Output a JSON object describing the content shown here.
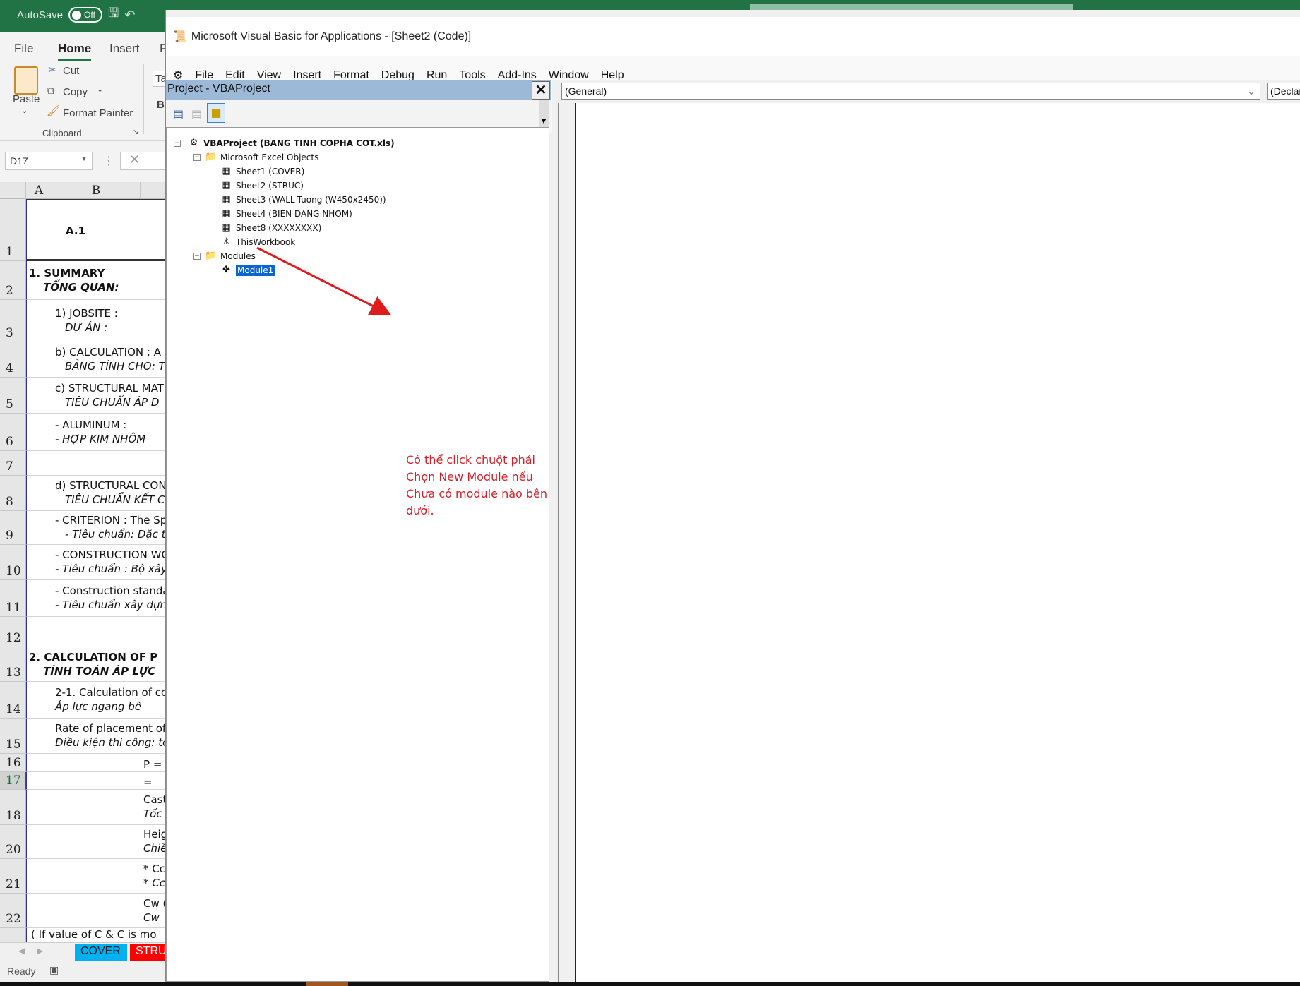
{
  "excel": {
    "autosave_label": "AutoSave",
    "autosave_state": "Off",
    "ribbon_tabs": [
      "File",
      "Home",
      "Insert",
      "P"
    ],
    "active_tab": "Home",
    "clipboard": {
      "paste": "Paste",
      "cut": "Cut",
      "copy": "Copy",
      "format_painter": "Format Painter",
      "group": "Clipboard"
    },
    "font_box_partial": "Ta",
    "bold_partial": "B",
    "name_box": "D17",
    "columns": [
      "A",
      "B"
    ],
    "rows": [
      {
        "n": "1",
        "lines": [
          {
            "t": "A.1",
            "s": "bold"
          }
        ]
      },
      {
        "n": "2",
        "lines": [
          {
            "t": "1. SUMMARY",
            "s": "bold"
          },
          {
            "t": "TỔNG QUAN:",
            "s": "bolditalic"
          }
        ]
      },
      {
        "n": "3",
        "lines": [
          {
            "t": "1) JOBSITE :",
            "s": ""
          },
          {
            "t": "DỰ ÁN :",
            "s": "italic"
          }
        ]
      },
      {
        "n": "4",
        "lines": [
          {
            "t": "b) CALCULATION : A",
            "s": ""
          },
          {
            "t": "BẢNG TÍNH CHO: T",
            "s": "italic"
          }
        ]
      },
      {
        "n": "5",
        "lines": [
          {
            "t": "c) STRUCTURAL MAT",
            "s": ""
          },
          {
            "t": "TIÊU CHUẨN ÁP D",
            "s": "italic"
          }
        ]
      },
      {
        "n": "6",
        "lines": [
          {
            "t": "- ALUMINUM :",
            "s": ""
          },
          {
            "t": "- HỢP KIM NHÔM",
            "s": "italic"
          }
        ]
      },
      {
        "n": "7",
        "lines": []
      },
      {
        "n": "8",
        "lines": [
          {
            "t": "d) STRUCTURAL CON",
            "s": ""
          },
          {
            "t": "TIÊU CHUẨN KẾT C",
            "s": "italic"
          }
        ]
      },
      {
        "n": "9",
        "lines": [
          {
            "t": "- CRITERION : The Spe",
            "s": ""
          },
          {
            "t": "- Tiêu chuẩn: Đặc trưng",
            "s": "italic"
          }
        ]
      },
      {
        "n": "10",
        "lines": [
          {
            "t": "- CONSTRUCTION WO",
            "s": ""
          },
          {
            "t": "- Tiêu chuẩn : Bộ xây d",
            "s": "italic"
          }
        ]
      },
      {
        "n": "11",
        "lines": [
          {
            "t": "- Construction standa",
            "s": ""
          },
          {
            "t": "- Tiêu chuẩn xây dựn",
            "s": "italic"
          }
        ]
      },
      {
        "n": "12",
        "lines": []
      },
      {
        "n": "13",
        "lines": [
          {
            "t": "2. CALCULATION OF P",
            "s": "bold"
          },
          {
            "t": "TÍNH TOÁN ÁP LỰC",
            "s": "bolditalic"
          }
        ]
      },
      {
        "n": "14",
        "lines": [
          {
            "t": "2-1. Calculation of co",
            "s": ""
          },
          {
            "t": "Áp lực ngang bê",
            "s": "italic"
          }
        ]
      },
      {
        "n": "15",
        "lines": [
          {
            "t": "Rate of placement of",
            "s": ""
          },
          {
            "t": "Điều kiện thi công: tố",
            "s": "italic"
          }
        ]
      },
      {
        "n": "16",
        "lines": [
          {
            "t": "P =",
            "s": ""
          }
        ]
      },
      {
        "n": "17",
        "lines": [
          {
            "t": "=",
            "s": ""
          }
        ]
      },
      {
        "n": "18",
        "lines": [
          {
            "t": "Cast",
            "s": ""
          },
          {
            "t": "Tốc",
            "s": "italic"
          }
        ]
      },
      {
        "n": "20",
        "lines": [
          {
            "t": "Heig",
            "s": ""
          },
          {
            "t": "Chiề",
            "s": "italic"
          }
        ]
      },
      {
        "n": "21",
        "lines": [
          {
            "t": "* Cc",
            "s": ""
          },
          {
            "t": "* Cc",
            "s": "italic"
          }
        ]
      },
      {
        "n": "22",
        "lines": [
          {
            "t": "Cw (",
            "s": ""
          },
          {
            "t": "Cw",
            "s": "italic"
          }
        ]
      },
      {
        "n": "",
        "lines": [
          {
            "t": "( If value of C & C   is mo",
            "s": ""
          }
        ]
      }
    ],
    "sheet_tabs": [
      {
        "label": "COVER",
        "color": "#00b0f0"
      },
      {
        "label": "STRU",
        "color": "#ff0000"
      }
    ],
    "status": "Ready"
  },
  "vba": {
    "title": "Microsoft Visual Basic for Applications - [Sheet2 (Code)]",
    "menu": [
      "File",
      "Edit",
      "View",
      "Insert",
      "Format",
      "Debug",
      "Run",
      "Tools",
      "Add-Ins",
      "Window",
      "Help"
    ],
    "project_title": "Project - VBAProject",
    "tree": {
      "root": "VBAProject (BANG TINH COPHA COT.xls)",
      "folder1": "Microsoft Excel Objects",
      "objects": [
        "Sheet1 (COVER)",
        "Sheet2 (STRUC)",
        "Sheet3 (WALL-Tuong (W450x2450))",
        "Sheet4 (BIEN DANG NHOM)",
        "Sheet8 (XXXXXXXX)",
        "ThisWorkbook"
      ],
      "folder2": "Modules",
      "modules": [
        "Module1"
      ],
      "selected": "Module1"
    },
    "object_dropdown": "(General)",
    "procedure_dropdown": "(Declar",
    "annotation": [
      "Có thể click chuột phải",
      "Chọn New Module nếu",
      "Chưa có module nào bên",
      "dưới."
    ],
    "annotation_color": "#d32029",
    "selection_color": "#0a64d2"
  }
}
